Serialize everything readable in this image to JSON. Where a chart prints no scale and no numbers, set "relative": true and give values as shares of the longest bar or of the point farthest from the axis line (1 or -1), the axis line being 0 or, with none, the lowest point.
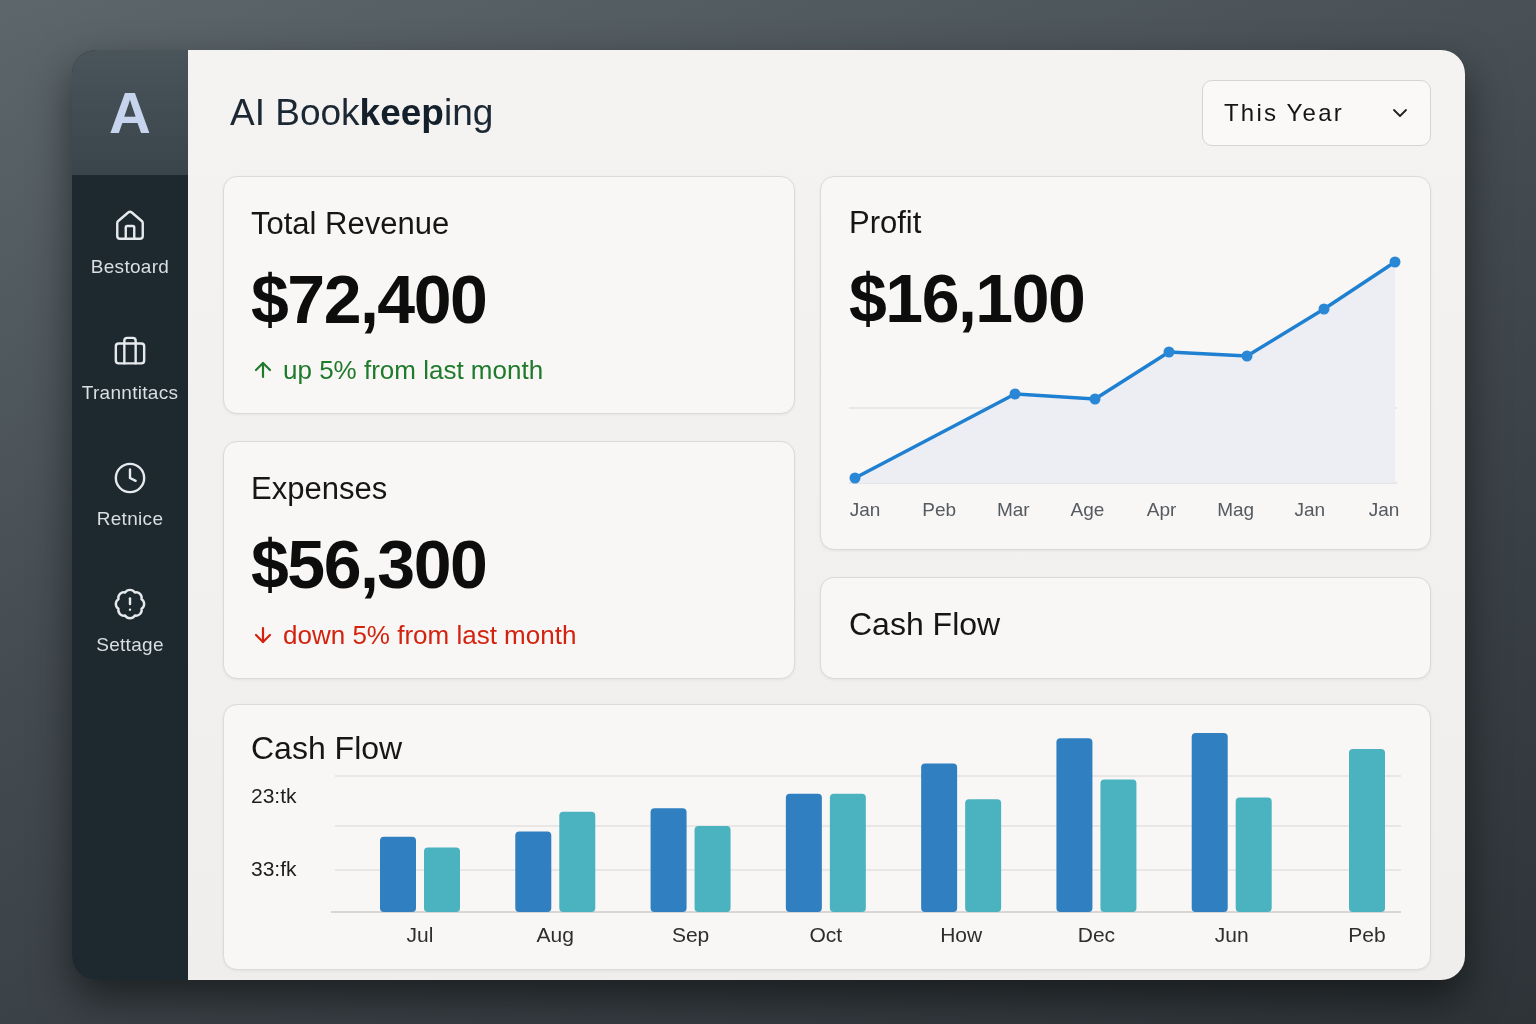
{
  "logo": "A",
  "sidebar": {
    "items": [
      {
        "label": "Bestoard"
      },
      {
        "label": "Tranntitacs"
      },
      {
        "label": "Retnice"
      },
      {
        "label": "Settage"
      }
    ]
  },
  "header": {
    "title": "AI Book**keep**ing",
    "period_select": {
      "value": "This Year"
    }
  },
  "stat_cards": [
    {
      "title": "Total Revenue",
      "amount": "$72,400",
      "trend": {
        "kind": "up",
        "text": "up 5% from last month"
      }
    },
    {
      "title": "Expenses",
      "amount": "$56,300",
      "trend": {
        "kind": "down",
        "text": "down 5% from last month"
      }
    }
  ],
  "profit_card": {
    "title": "Profit",
    "amount": "$16,100",
    "axis_labels": [
      "Jan",
      "Peb",
      "Mar",
      "Age",
      "Apr",
      "Mag",
      "Jan",
      "Jan"
    ]
  },
  "cash_flow_summary": {
    "title": "Cash Flow"
  },
  "cash_flow_chart": {
    "title": "Cash Flow",
    "y_axis_labels": [
      "23:tk",
      "33:fk"
    ],
    "chart_data": {
      "type": "bar",
      "relative": true,
      "categories": [
        "Jul",
        "Aug",
        "Sep",
        "Oct",
        "How",
        "Dec",
        "Jun",
        "Peb"
      ],
      "series": [
        {
          "color": "#2f7fc1",
          "values": [
            0.42,
            0.45,
            0.58,
            0.66,
            0.83,
            0.97,
            1.0,
            null
          ]
        },
        {
          "color": "#4bb3c0",
          "values": [
            0.36,
            0.56,
            0.48,
            0.66,
            0.63,
            0.74,
            0.64,
            0.91
          ]
        }
      ]
    }
  }
}
